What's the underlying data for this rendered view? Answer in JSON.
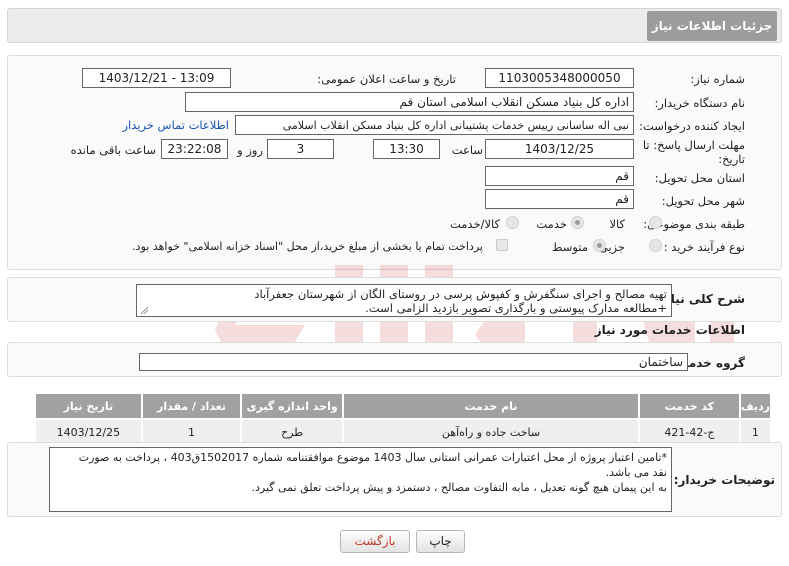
{
  "header": {
    "title": "جزئیات اطلاعات نیاز"
  },
  "fields": {
    "need_number_label": "شماره نیاز:",
    "need_number": "1103005348000050",
    "announce_label": "تاریخ و ساعت اعلان عمومی:",
    "announce_value": "1403/12/21 - 13:09",
    "buyer_org_label": "نام دستگاه خریدار:",
    "buyer_org": "اداره کل بنیاد مسکن انقلاب اسلامی استان قم",
    "creator_label": "ایجاد کننده درخواست:",
    "creator": "نبی اله ساسانی رییس خدمات پشتیبانی اداره کل بنیاد مسکن انقلاب اسلامی",
    "contact_link": "اطلاعات تماس خریدار",
    "deadline_label_line1": "مهلت ارسال پاسخ: تا",
    "deadline_label_line2": "تاریخ:",
    "deadline_date": "1403/12/25",
    "time_label": "ساعت",
    "deadline_time": "13:30",
    "days_value": "3",
    "days_label": "روز و",
    "remaining_value": "23:22:08",
    "remaining_label": "ساعت باقی مانده",
    "province_label": "استان محل تحویل:",
    "province": "قم",
    "city_label": "شهر محل تحویل:",
    "city": "قم",
    "category_label": "طبقه بندی موضوعی:",
    "category_options": [
      "کالا",
      "خدمت",
      "کالا/خدمت"
    ],
    "process_label": "نوع فرآیند خرید :",
    "process_options": [
      "جزیی",
      "متوسط"
    ],
    "payment_note": "پرداخت تمام یا بخشی از مبلغ خرید،از محل \"اسناد خزانه اسلامی\" خواهد بود."
  },
  "summary": {
    "label": "شرح کلی نیاز:",
    "line1": "تهیه مصالح و اجرای سنگفرش و کفپوش پرسی در روستای الگان از شهرستان جعفرآباد",
    "line2": "+مطالعه مدارک پیوستی و بارگذاری تصویر بازدید الزامی است."
  },
  "services": {
    "section_title": "اطلاعات خدمات مورد نیاز",
    "group_label": "گروه خدمت:",
    "group_value": "ساختمان",
    "columns": [
      "ردیف",
      "کد خدمت",
      "نام خدمت",
      "واحد اندازه گیری",
      "تعداد / مقدار",
      "تاریخ نیاز"
    ],
    "rows": [
      {
        "row": "1",
        "code": "ج-42-421",
        "name": "ساخت جاده و راه‌آهن",
        "unit": "طرح",
        "qty": "1",
        "date": "1403/12/25"
      }
    ]
  },
  "buyer_notes": {
    "label": "توضیحات خریدار:",
    "line1": "*تامین اعتبار پروژه از محل اعتبارات عمرانی استانی سال 1403 موضوع موافقتنامه شماره 1502017ق403 ، پرداخت به صورت",
    "line2": "نقد می باشد.",
    "line3": "به این پیمان هیچ گونه تعدیل ، مابه التفاوت مصالح ، دستمزد و پیش پرداخت تعلق نمی گیرد."
  },
  "buttons": {
    "print": "چاپ",
    "back": "بازگشت"
  },
  "colors": {
    "header_tab": "#9c9c9c",
    "table_header": "#a1a1a1",
    "link": "#1a55b0",
    "back_text": "#c0392b"
  }
}
